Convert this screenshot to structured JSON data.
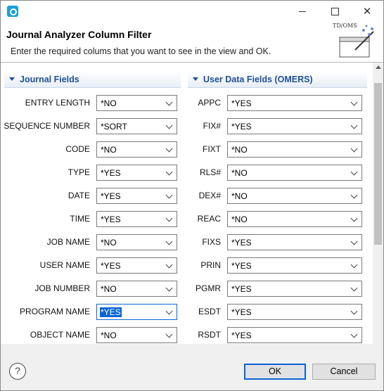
{
  "window": {
    "title": "",
    "colors": {
      "accent": "#0a64d6",
      "section_text": "#1f4f9a",
      "arrow": "#e03a3e"
    }
  },
  "header": {
    "title": "Journal Analyzer Column Filter",
    "subtitle": "Enter the required colums that you want to see in the view and OK.",
    "logo_text": "TD/OMS"
  },
  "sections": {
    "journal": {
      "title": "Journal Fields"
    },
    "user": {
      "title": "User Data Fields (OMERS)"
    }
  },
  "journal_fields": [
    {
      "label": "ENTRY LENGTH",
      "value": "*NO"
    },
    {
      "label": "SEQUENCE NUMBER",
      "value": "*SORT"
    },
    {
      "label": "CODE",
      "value": "*NO"
    },
    {
      "label": "TYPE",
      "value": "*YES"
    },
    {
      "label": "DATE",
      "value": "*YES"
    },
    {
      "label": "TIME",
      "value": "*YES"
    },
    {
      "label": "JOB NAME",
      "value": "*NO"
    },
    {
      "label": "USER NAME",
      "value": "*YES"
    },
    {
      "label": "JOB NUMBER",
      "value": "*NO"
    },
    {
      "label": "PROGRAM NAME",
      "value": "*YES"
    },
    {
      "label": "OBJECT NAME",
      "value": "*NO"
    }
  ],
  "user_fields": [
    {
      "label": "APPC",
      "value": "*YES"
    },
    {
      "label": "FIX#",
      "value": "*YES"
    },
    {
      "label": "FIXT",
      "value": "*NO"
    },
    {
      "label": "RLS#",
      "value": "*NO"
    },
    {
      "label": "DEX#",
      "value": "*NO"
    },
    {
      "label": "REAC",
      "value": "*NO"
    },
    {
      "label": "FIXS",
      "value": "*YES"
    },
    {
      "label": "PRIN",
      "value": "*YES"
    },
    {
      "label": "PGMR",
      "value": "*YES"
    },
    {
      "label": "ESDT",
      "value": "*YES"
    },
    {
      "label": "RSDT",
      "value": "*YES"
    }
  ],
  "footer": {
    "help": "?",
    "ok_label": "OK",
    "cancel_label": "Cancel"
  }
}
